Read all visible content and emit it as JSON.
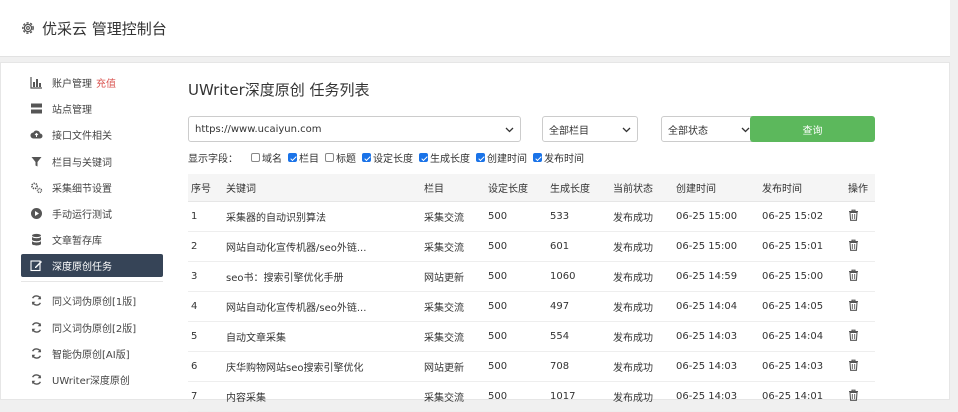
{
  "header": {
    "title": "优采云 管理控制台"
  },
  "sidebar": {
    "items": [
      {
        "label": "账户管理",
        "badge": "充值",
        "icon": "bar-chart-icon"
      },
      {
        "label": "站点管理",
        "icon": "server-icon"
      },
      {
        "label": "接口文件相关",
        "icon": "cloud-upload-icon"
      },
      {
        "label": "栏目与关键词",
        "icon": "filter-icon"
      },
      {
        "label": "采集细节设置",
        "icon": "gears-icon"
      },
      {
        "label": "手动运行测试",
        "icon": "play-circle-icon"
      },
      {
        "label": "文章暂存库",
        "icon": "database-icon"
      },
      {
        "label": "深度原创任务",
        "icon": "edit-icon",
        "active": true
      },
      {
        "label": "同义词伪原创[1版]",
        "icon": "refresh-icon"
      },
      {
        "label": "同义词伪原创[2版]",
        "icon": "refresh-icon"
      },
      {
        "label": "智能伪原创[AI版]",
        "icon": "refresh-icon"
      },
      {
        "label": "UWriter深度原创",
        "icon": "refresh-icon"
      }
    ]
  },
  "main": {
    "title": "UWriter深度原创 任务列表",
    "filters": {
      "site": "https://www.ucaiyun.com",
      "column": "全部栏目",
      "status": "全部状态",
      "query_label": "查询"
    },
    "fields": {
      "label": "显示字段：",
      "options": [
        {
          "label": "域名",
          "checked": false
        },
        {
          "label": "栏目",
          "checked": true
        },
        {
          "label": "标题",
          "checked": false
        },
        {
          "label": "设定长度",
          "checked": true
        },
        {
          "label": "生成长度",
          "checked": true
        },
        {
          "label": "创建时间",
          "checked": true
        },
        {
          "label": "发布时间",
          "checked": true
        }
      ]
    },
    "table": {
      "headers": [
        "序号",
        "关键词",
        "栏目",
        "设定长度",
        "生成长度",
        "当前状态",
        "创建时间",
        "发布时间",
        "操作"
      ],
      "rows": [
        [
          "1",
          "采集器的自动识别算法",
          "采集交流",
          "500",
          "533",
          "发布成功",
          "06-25 15:00",
          "06-25 15:02"
        ],
        [
          "2",
          "网站自动化宣传机器/seo外链...",
          "采集交流",
          "500",
          "601",
          "发布成功",
          "06-25 15:00",
          "06-25 15:01"
        ],
        [
          "3",
          "seo书：搜索引擎优化手册",
          "网站更新",
          "500",
          "1060",
          "发布成功",
          "06-25 14:59",
          "06-25 15:00"
        ],
        [
          "4",
          "网站自动化宣传机器/seo外链...",
          "采集交流",
          "500",
          "497",
          "发布成功",
          "06-25 14:04",
          "06-25 14:05"
        ],
        [
          "5",
          "自动文章采集",
          "采集交流",
          "500",
          "554",
          "发布成功",
          "06-25 14:03",
          "06-25 14:04"
        ],
        [
          "6",
          "庆华购物网站seo搜索引擎优化",
          "网站更新",
          "500",
          "708",
          "发布成功",
          "06-25 14:03",
          "06-25 14:03"
        ],
        [
          "7",
          "内容采集",
          "采集交流",
          "500",
          "1017",
          "发布成功",
          "06-25 14:03",
          "06-25 14:01"
        ]
      ]
    }
  },
  "colors": {
    "active_bg": "#364457",
    "query_btn": "#5cb85c",
    "status_ok": "#2e7d32",
    "checkbox": "#1a73e8"
  }
}
